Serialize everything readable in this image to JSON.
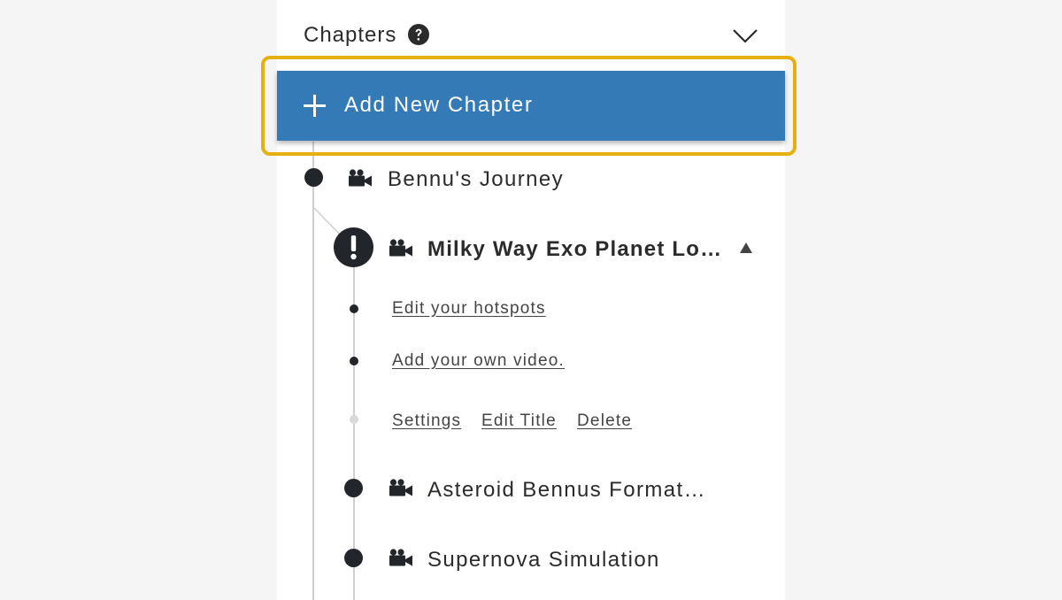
{
  "header": {
    "title": "Chapters",
    "help_icon": "question-circle-icon",
    "collapse_icon": "chevron-down-icon"
  },
  "add_chapter": {
    "label": "Add New Chapter",
    "icon": "plus-icon",
    "highlight_color": "#e6b012",
    "bg_color": "#337ab7"
  },
  "chapters": [
    {
      "title": "Bennu's Journey",
      "icon": "video-camera-icon"
    },
    {
      "title": "Milky Way Exo Planet Lo…",
      "icon": "video-camera-icon",
      "status_icon": "exclamation-icon",
      "expanded": true,
      "toggle_icon": "triangle-up-icon"
    },
    {
      "title": "Asteroid Bennus Format…",
      "icon": "video-camera-icon"
    },
    {
      "title": "Supernova Simulation",
      "icon": "video-camera-icon"
    }
  ],
  "active_chapter": {
    "steps": [
      {
        "label": "Edit your hotspots"
      },
      {
        "label": "Add your own video."
      }
    ],
    "actions": {
      "settings": "Settings",
      "edit_title": "Edit Title",
      "delete": "Delete"
    }
  }
}
